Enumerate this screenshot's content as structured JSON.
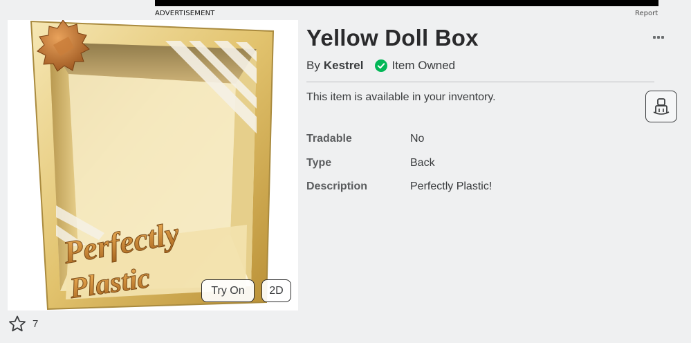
{
  "ad": {
    "label": "ADVERTISEMENT",
    "report": "Report"
  },
  "item": {
    "title": "Yellow Doll Box",
    "by_prefix": "By",
    "creator": "Kestrel",
    "owned_label": "Item Owned",
    "availability": "This item is available in your inventory.",
    "try_on_label": "Try On",
    "view_2d_label": "2D",
    "favorites": "7",
    "thumbnail_text_line1": "Perfectly",
    "thumbnail_text_line2": "Plastic"
  },
  "details": [
    {
      "label": "Tradable",
      "value": "No"
    },
    {
      "label": "Type",
      "value": "Back"
    },
    {
      "label": "Description",
      "value": "Perfectly Plastic!"
    }
  ],
  "colors": {
    "owned_green": "#02b757",
    "gold": "#d9b65a",
    "ad_bar": "#000000"
  },
  "icons": {
    "menu": "ellipsis-icon",
    "owned": "check-circle-icon",
    "favorite": "star-outline-icon",
    "avatar": "avatar-preview-icon",
    "badge": "limited-badge-icon"
  }
}
